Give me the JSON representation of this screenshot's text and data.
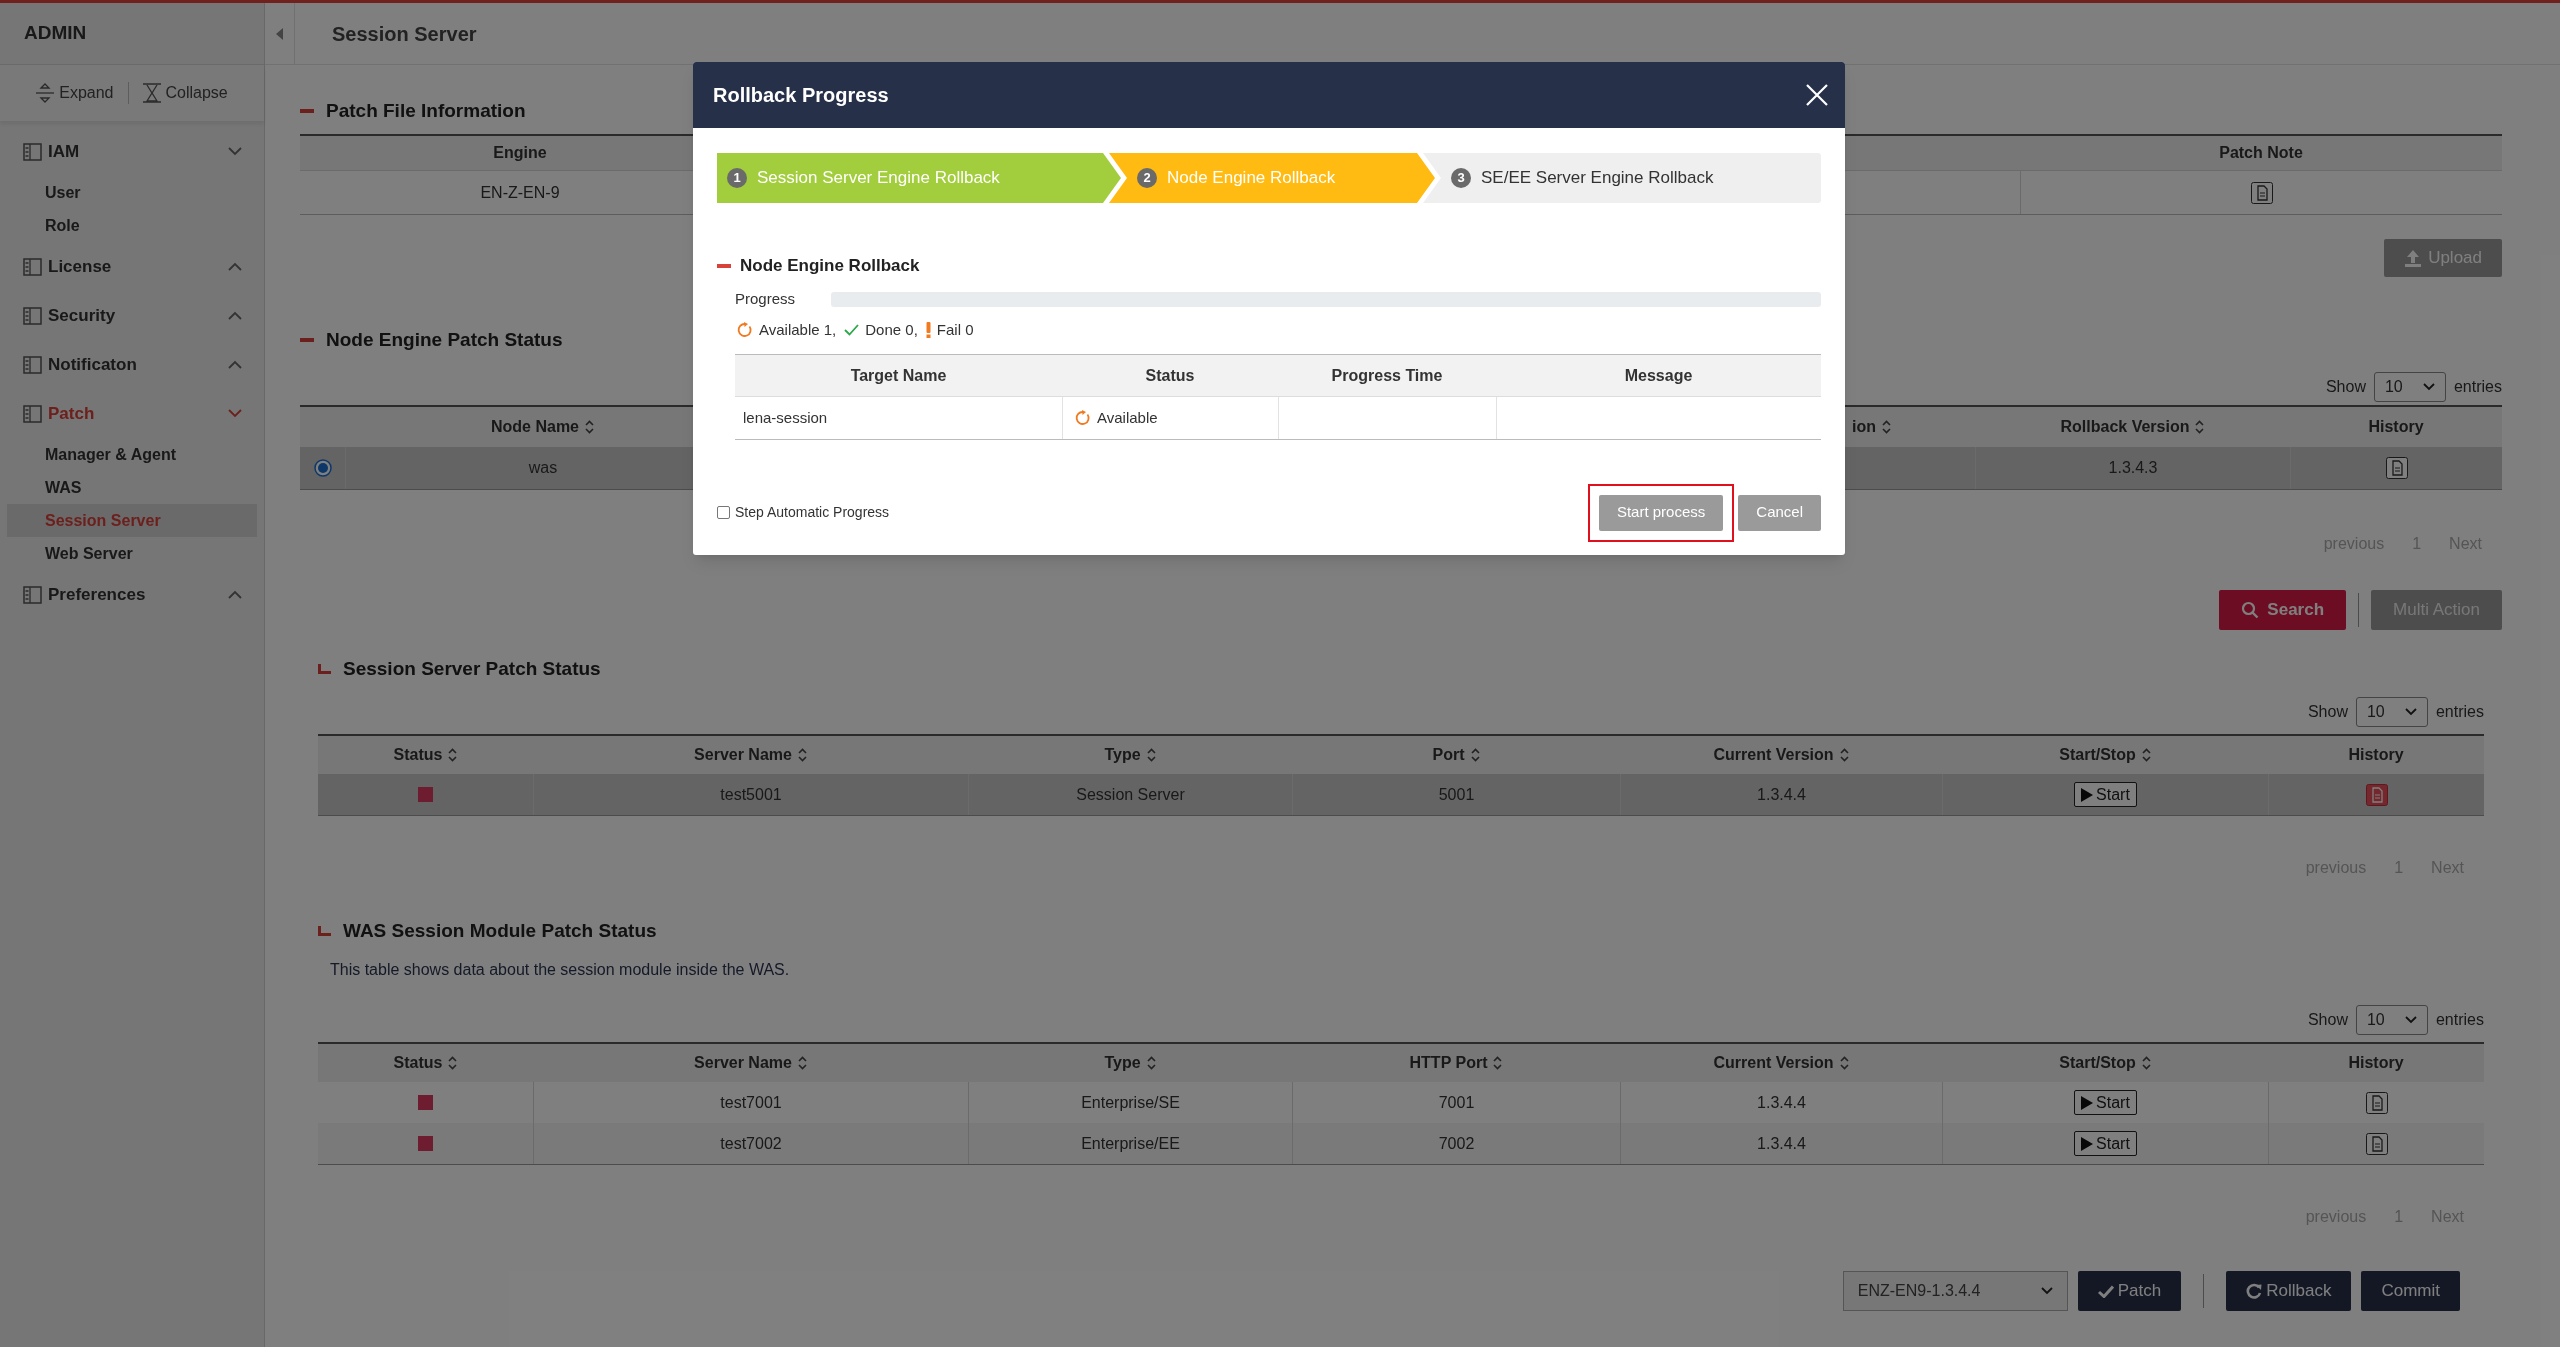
{
  "sidebar": {
    "title": "ADMIN",
    "tools": [
      {
        "label": "Expand",
        "kind": "expand"
      },
      {
        "label": "Collapse",
        "kind": "collapse"
      }
    ],
    "menu": [
      {
        "label": "IAM",
        "expanded": true,
        "selected": false,
        "children": [
          {
            "label": "User",
            "selected": false
          },
          {
            "label": "Role",
            "selected": false
          }
        ]
      },
      {
        "label": "License",
        "expanded": false,
        "selected": false
      },
      {
        "label": "Security",
        "expanded": false,
        "selected": false
      },
      {
        "label": "Notificaton",
        "expanded": false,
        "selected": false
      },
      {
        "label": "Patch",
        "expanded": true,
        "selected": true,
        "children": [
          {
            "label": "Manager & Agent",
            "selected": false
          },
          {
            "label": "WAS",
            "selected": false
          },
          {
            "label": "Session Server",
            "selected": true
          },
          {
            "label": "Web Server",
            "selected": false
          }
        ]
      },
      {
        "label": "Preferences",
        "expanded": false,
        "selected": false
      }
    ]
  },
  "header": {
    "title": "Session Server"
  },
  "patch_file": {
    "title": "Patch File Information",
    "columns": [
      {
        "label": "Engine"
      },
      {
        "label": "Patch Note"
      }
    ],
    "row": {
      "engine": "EN-Z-EN-9"
    },
    "upload": "Upload"
  },
  "node_status": {
    "title": "Node Engine Patch Status",
    "show": "Show",
    "page_size": "10",
    "entries": "entries",
    "columns": [
      {
        "label": "Node Name",
        "sortable": true
      },
      {
        "label": "ion",
        "sortable": true
      },
      {
        "label": "Rollback Version",
        "sortable": true
      },
      {
        "label": "History",
        "sortable": false
      }
    ],
    "rows": [
      {
        "selected": true,
        "node_name": "was",
        "rollback_version": "1.3.4.3"
      }
    ],
    "pagination": {
      "previous": "previous",
      "page": "1",
      "next": "Next"
    },
    "actions": [
      {
        "label": "Search",
        "kind": "primary"
      },
      {
        "label": "Multi Action",
        "kind": "secondary"
      }
    ]
  },
  "session_status": {
    "title": "Session Server Patch Status",
    "show": "Show",
    "page_size": "10",
    "entries": "entries",
    "columns": [
      {
        "label": "Status",
        "sortable": true
      },
      {
        "label": "Server Name",
        "sortable": true
      },
      {
        "label": "Type",
        "sortable": true
      },
      {
        "label": "Port",
        "sortable": true
      },
      {
        "label": "Current Version",
        "sortable": true
      },
      {
        "label": "Start/Stop",
        "sortable": true
      },
      {
        "label": "History",
        "sortable": false
      }
    ],
    "rows": [
      {
        "running": false,
        "selected": true,
        "server_name": "test5001",
        "type": "Session Server",
        "port": "5001",
        "current_version": "1.3.4.4",
        "action": "Start",
        "history_highlighted": true
      }
    ],
    "pagination": {
      "previous": "previous",
      "page": "1",
      "next": "Next"
    }
  },
  "was_status": {
    "title": "WAS Session Module Patch Status",
    "description": "This table shows data about the session module inside the WAS.",
    "show": "Show",
    "page_size": "10",
    "entries": "entries",
    "columns": [
      {
        "label": "Status",
        "sortable": true
      },
      {
        "label": "Server Name",
        "sortable": true
      },
      {
        "label": "Type",
        "sortable": true
      },
      {
        "label": "HTTP Port",
        "sortable": true
      },
      {
        "label": "Current Version",
        "sortable": true
      },
      {
        "label": "Start/Stop",
        "sortable": true
      },
      {
        "label": "History",
        "sortable": false
      }
    ],
    "rows": [
      {
        "running": false,
        "selected": false,
        "server_name": "test7001",
        "type": "Enterprise/SE",
        "port": "7001",
        "current_version": "1.3.4.4",
        "action": "Start",
        "history_highlighted": false
      },
      {
        "running": false,
        "selected": false,
        "server_name": "test7002",
        "type": "Enterprise/EE",
        "port": "7002",
        "current_version": "1.3.4.4",
        "action": "Start",
        "history_highlighted": false
      }
    ],
    "pagination": {
      "previous": "previous",
      "page": "1",
      "next": "Next"
    }
  },
  "bottom_bar": {
    "version_select": "ENZ-EN9-1.3.4.4",
    "buttons": [
      {
        "label": "Patch",
        "kind": "check"
      },
      {
        "label": "Rollback",
        "kind": "redo"
      },
      {
        "label": "Commit",
        "kind": "plain"
      }
    ]
  },
  "modal": {
    "title": "Rollback Progress",
    "steps": [
      {
        "number": "1",
        "label": "Session Server Engine Rollback",
        "done": true,
        "active": false
      },
      {
        "number": "2",
        "label": "Node Engine Rollback",
        "done": false,
        "active": true
      },
      {
        "number": "3",
        "label": "SE/EE Server Engine Rollback",
        "done": false,
        "active": false
      }
    ],
    "section_title": "Node Engine Rollback",
    "progress_label": "Progress",
    "level": 0,
    "summary": [
      {
        "kind": "available",
        "text": "Available 1,"
      },
      {
        "kind": "done",
        "text": "Done 0,"
      },
      {
        "kind": "fail",
        "text": "Fail 0"
      }
    ],
    "columns": [
      {
        "label": "Target Name"
      },
      {
        "label": "Status"
      },
      {
        "label": "Progress Time"
      },
      {
        "label": "Message"
      }
    ],
    "rows": [
      {
        "target_name": "lena-session",
        "status": "Available",
        "kind": "available"
      }
    ],
    "auto_progress": {
      "label": "Step Automatic Progress",
      "checked": false
    },
    "buttons": [
      {
        "label": "Start process",
        "highlighted": true
      },
      {
        "label": "Cancel",
        "highlighted": false
      }
    ]
  }
}
